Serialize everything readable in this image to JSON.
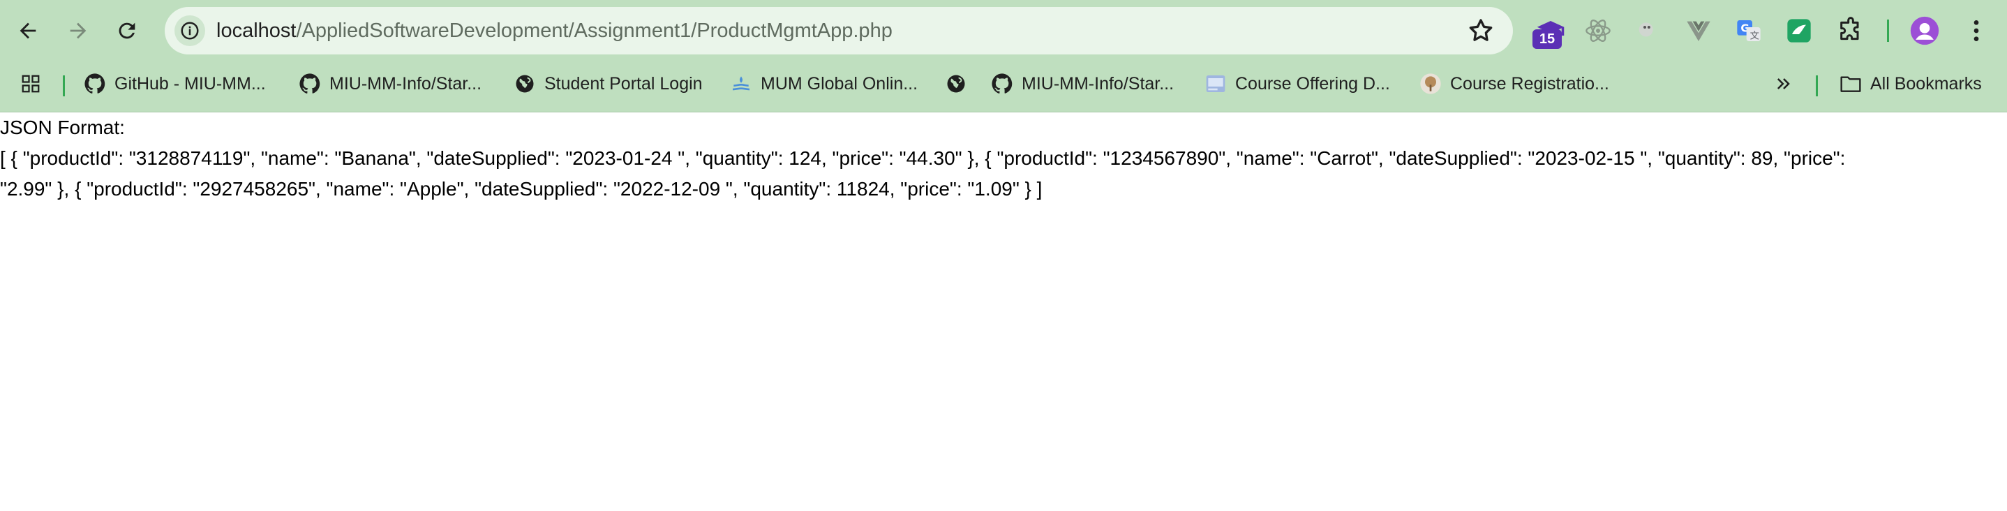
{
  "browser": {
    "url_host": "localhost",
    "url_path": "/AppliedSoftwareDevelopment/Assignment1/ProductMgmtApp.php",
    "extension_badge": "15",
    "accent_color": "#bfdfbf",
    "nav": {
      "back_icon": "arrow-left-icon",
      "forward_icon": "arrow-right-icon",
      "reload_icon": "reload-icon"
    }
  },
  "bookmarks": {
    "items": [
      {
        "label": "GitHub - MIU-MM...",
        "icon": "github-icon"
      },
      {
        "label": "MIU-MM-Info/Star...",
        "icon": "github-icon"
      },
      {
        "label": "Student Portal Login",
        "icon": "globe-icon"
      },
      {
        "label": "MUM Global Onlin...",
        "icon": "fountain-icon"
      },
      {
        "label": "",
        "icon": "globe-icon"
      },
      {
        "label": "MIU-MM-Info/Star...",
        "icon": "github-icon"
      },
      {
        "label": "Course Offering D...",
        "icon": "course-icon"
      },
      {
        "label": "Course Registratio...",
        "icon": "tree-icon"
      }
    ],
    "all_bookmarks_label": "All Bookmarks"
  },
  "page": {
    "heading": "JSON Format:",
    "json_line_1": "[ { \"productId\": \"3128874119\", \"name\": \"Banana\", \"dateSupplied\": \"2023-01-24 \", \"quantity\": 124, \"price\": \"44.30\" }, { \"productId\": \"1234567890\", \"name\": \"Carrot\", \"dateSupplied\": \"2023-02-15 \", \"quantity\": 89, \"price\":",
    "json_line_2": "\"2.99\" }, { \"productId\": \"2927458265\", \"name\": \"Apple\", \"dateSupplied\": \"2022-12-09 \", \"quantity\": 11824, \"price\": \"1.09\" } ]"
  }
}
